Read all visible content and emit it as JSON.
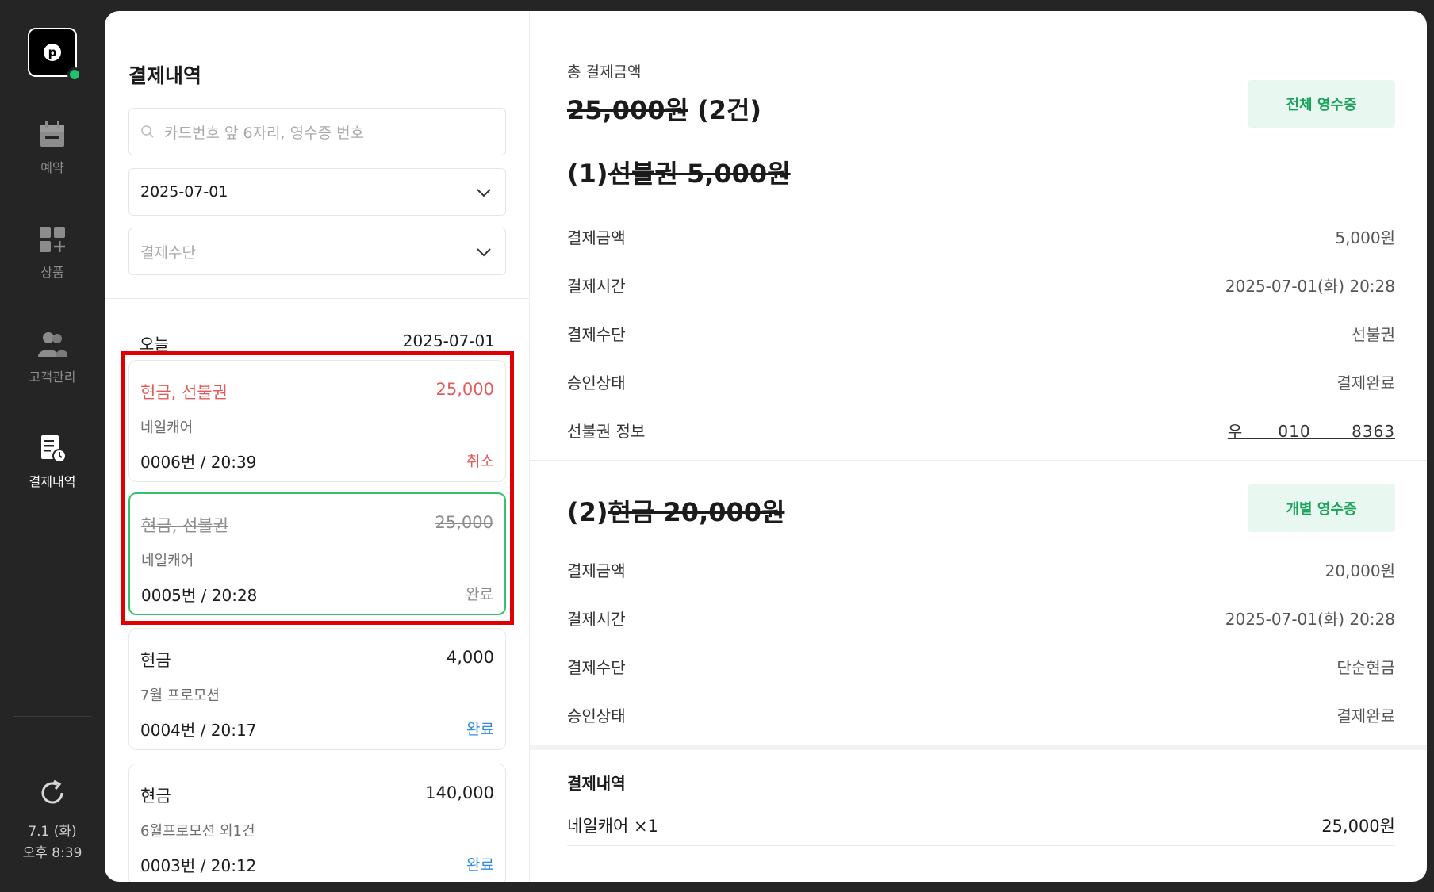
{
  "rail": {
    "logo_letter": "p",
    "items": [
      {
        "label": "예약",
        "icon": "calendar-icon"
      },
      {
        "label": "상품",
        "icon": "grid-plus-icon"
      },
      {
        "label": "고객관리",
        "icon": "people-icon"
      },
      {
        "label": "결제내역",
        "icon": "receipt-clock-icon"
      }
    ],
    "date": "7.1 (화)",
    "time": "오후 8:39"
  },
  "list": {
    "title": "결제내역",
    "search_placeholder": "카드번호 앞 6자리, 영수증 번호",
    "date_value": "2025-07-01",
    "method_placeholder": "결제수단",
    "day_label": "오늘",
    "day_date": "2025-07-01",
    "cards": [
      {
        "method": "현금, 선불권",
        "amount": "25,000",
        "product": "네일캐어",
        "number": "0006번 / 20:39",
        "status": "취소"
      },
      {
        "method": "현금, 선불권",
        "amount": "25,000",
        "product": "네일캐어",
        "number": "0005번 / 20:28",
        "status": "완료"
      },
      {
        "method": "현금",
        "amount": "4,000",
        "product": "7월 프로모션",
        "number": "0004번 / 20:17",
        "status": "완료"
      },
      {
        "method": "현금",
        "amount": "140,000",
        "product": "6월프로모션 외1건",
        "number": "0003번 / 20:12",
        "status": "완료"
      }
    ]
  },
  "detail": {
    "total_label": "총 결제금액",
    "total_amount": "25,000원",
    "total_count": "(2건)",
    "all_receipt": "전체 영수증",
    "section1": {
      "prefix": "(1)",
      "title": "선불권 5,000원",
      "rows": [
        {
          "k": "결제금액",
          "v": "5,000원"
        },
        {
          "k": "결제시간",
          "v": "2025-07-01(화) 20:28"
        },
        {
          "k": "결제수단",
          "v": "선불권"
        },
        {
          "k": "승인상태",
          "v": "결제완료"
        },
        {
          "k": "선불권 정보",
          "v": "우      010       8363"
        }
      ]
    },
    "section2": {
      "prefix": "(2)",
      "title": "현금 20,000원",
      "receipt": "개별 영수증",
      "rows": [
        {
          "k": "결제금액",
          "v": "20,000원"
        },
        {
          "k": "결제시간",
          "v": "2025-07-01(화) 20:28"
        },
        {
          "k": "결제수단",
          "v": "단순현금"
        },
        {
          "k": "승인상태",
          "v": "결제완료"
        }
      ]
    },
    "history_title": "결제내역",
    "history_item": "네일캐어 ×1",
    "history_amount": "25,000원"
  }
}
